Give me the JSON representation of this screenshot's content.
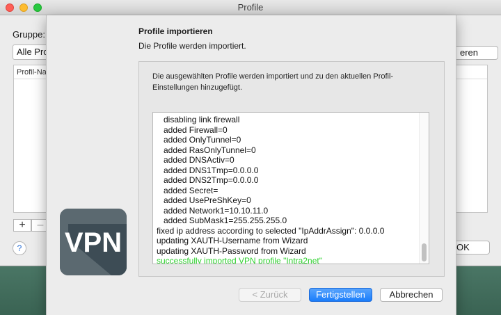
{
  "window": {
    "title": "Profile"
  },
  "main": {
    "group_label": "Gruppe:",
    "group_value": "Alle Pro",
    "list_header": "Profil-Na",
    "add_label": "+",
    "remove_label": "–",
    "help_label": "?",
    "right_button_partial": "eren",
    "ok_button_partial": "OK"
  },
  "sheet": {
    "title": "Profile importieren",
    "subtitle": "Die Profile werden importiert.",
    "info_text": "Die ausgewählten Profile werden importiert und zu den aktuellen Profil-Einstellungen hinzugefügt.",
    "logo_text": "VPN",
    "log_lines": [
      "   disabling link firewall",
      "   added Firewall=0",
      "   added OnlyTunnel=0",
      "   added RasOnlyTunnel=0",
      "   added DNSActiv=0",
      "   added DNS1Tmp=0.0.0.0",
      "   added DNS2Tmp=0.0.0.0",
      "   added Secret=",
      "   added UsePreShKey=0",
      "   added Network1=10.10.11.0",
      "   added SubMask1=255.255.255.0",
      "fixed ip address according to selected \"IpAddrAssign\": 0.0.0.0",
      "updating XAUTH-Username from Wizard",
      "updating XAUTH-Password from Wizard",
      "successfully imported VPN profile \"Intra2net\""
    ],
    "buttons": {
      "back": "< Zurück",
      "finish": "Fertigstellen",
      "cancel": "Abbrechen"
    }
  },
  "colors": {
    "success_text": "#2ed12e",
    "primary_button": "#1a7dfb",
    "logo_background": "#5b6970",
    "logo_shadow": "#3d4c55"
  }
}
